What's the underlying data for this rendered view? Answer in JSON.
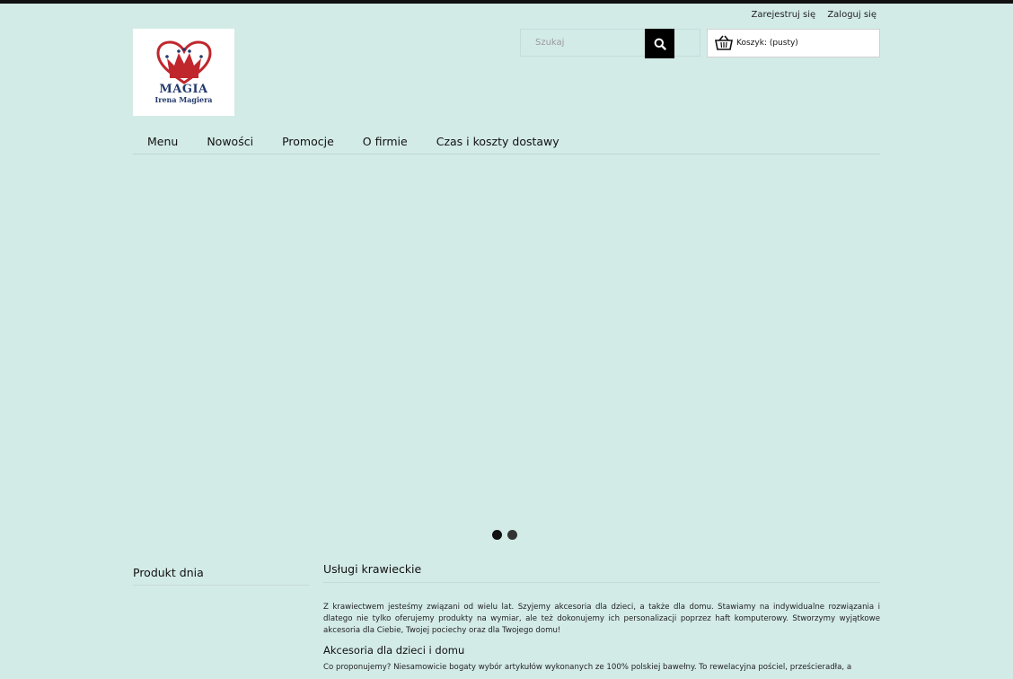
{
  "header": {
    "register_label": "Zarejestruj się",
    "login_label": "Zaloguj się"
  },
  "logo": {
    "brand": "MAGIA",
    "subtitle": "Irena Magiera",
    "colors": {
      "heart": "#c0272d",
      "text": "#233a6b"
    }
  },
  "search": {
    "placeholder": "Szukaj",
    "icon": "search-icon"
  },
  "cart": {
    "label": "Koszyk:",
    "status": "(pusty)",
    "icon": "basket-icon"
  },
  "nav": {
    "items": [
      {
        "label": "Menu"
      },
      {
        "label": "Nowości"
      },
      {
        "label": "Promocje"
      },
      {
        "label": "O firmie"
      },
      {
        "label": "Czas i koszty dostawy"
      }
    ]
  },
  "slider": {
    "slide_count": 2,
    "active_index": 0
  },
  "sidebar": {
    "title": "Produkt dnia"
  },
  "content": {
    "title": "Usługi krawieckie",
    "paragraph1": "Z krawiectwem jesteśmy związani od wielu lat. Szyjemy akcesoria dla dzieci, a także dla domu. Stawiamy na indywidualne rozwiązania i dlatego nie tylko oferujemy produkty na wymiar, ale też dokonujemy ich personalizacji poprzez haft komputerowy. Stworzymy wyjątkowe akcesoria dla Ciebie, Twojej pociechy oraz dla Twojego domu!",
    "subtitle": "Akcesoria dla dzieci i domu",
    "paragraph2": "Co proponujemy? Niesamowicie bogaty wybór artykułów wykonanych ze 100% polskiej bawełny. To rewelacyjna pościel, prześcieradła, a"
  },
  "colors": {
    "background": "#d3ebe7",
    "topbar": "#111111",
    "search_button": "#000000"
  }
}
